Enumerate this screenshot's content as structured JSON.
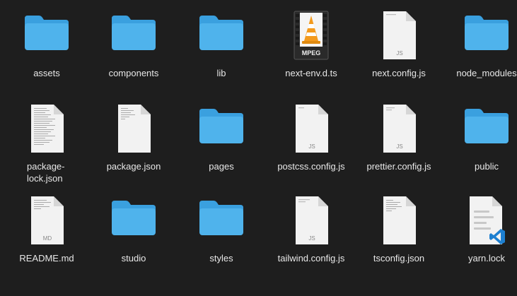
{
  "colors": {
    "background": "#1e1e1e",
    "folder": "#4fb3ec",
    "folder_tab": "#3aa0df",
    "doc": "#f2f2f2",
    "text": "#e8e8e8",
    "vscode": "#1d7fd0",
    "vlc_orange": "#f39a1d"
  },
  "items": [
    {
      "label": "assets",
      "icon": "folder-icon"
    },
    {
      "label": "components",
      "icon": "folder-icon"
    },
    {
      "label": "lib",
      "icon": "folder-icon"
    },
    {
      "label": "next-env.d.ts",
      "icon": "vlc-mpeg-icon",
      "badge": "MPEG"
    },
    {
      "label": "next.config.js",
      "icon": "js-file-icon",
      "badge": "JS"
    },
    {
      "label": "node_modules",
      "icon": "folder-icon"
    },
    {
      "label": "package-lock.json",
      "icon": "text-file-icon"
    },
    {
      "label": "package.json",
      "icon": "text-file-icon"
    },
    {
      "label": "pages",
      "icon": "folder-icon"
    },
    {
      "label": "postcss.config.js",
      "icon": "js-file-icon",
      "badge": "JS"
    },
    {
      "label": "prettier.config.js",
      "icon": "js-file-icon",
      "badge": "JS"
    },
    {
      "label": "public",
      "icon": "folder-icon"
    },
    {
      "label": "README.md",
      "icon": "md-file-icon",
      "badge": "MD"
    },
    {
      "label": "studio",
      "icon": "folder-icon"
    },
    {
      "label": "styles",
      "icon": "folder-icon"
    },
    {
      "label": "tailwind.config.js",
      "icon": "js-file-icon",
      "badge": "JS"
    },
    {
      "label": "tsconfig.json",
      "icon": "text-file-icon"
    },
    {
      "label": "yarn.lock",
      "icon": "vscode-file-icon"
    }
  ]
}
